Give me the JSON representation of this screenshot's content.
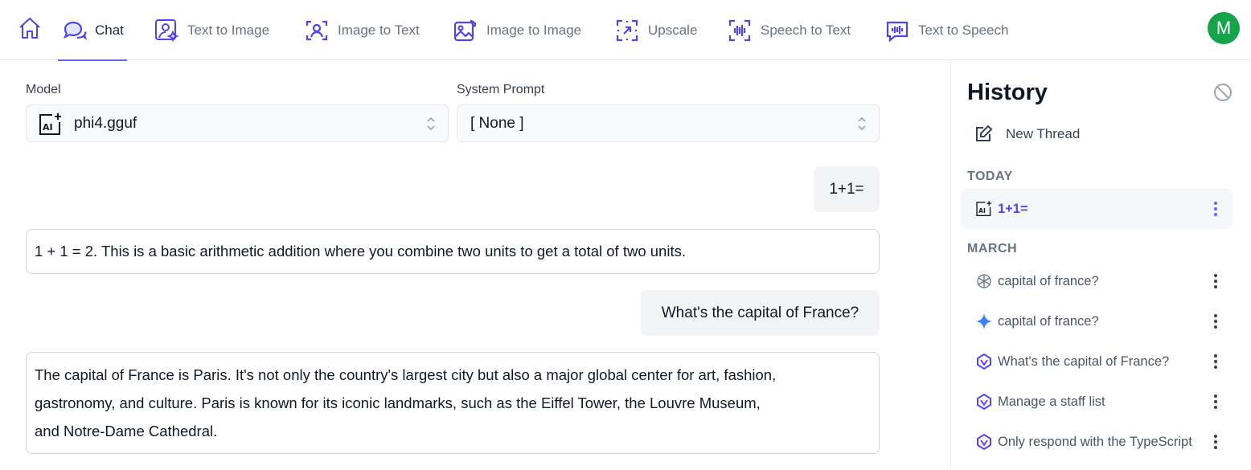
{
  "topnav": {
    "tabs": [
      {
        "label": "Chat",
        "icon": "chat-icon",
        "active": true
      },
      {
        "label": "Text to Image",
        "icon": "text-to-image-icon"
      },
      {
        "label": "Image to Text",
        "icon": "image-to-text-icon"
      },
      {
        "label": "Image to Image",
        "icon": "image-to-image-icon"
      },
      {
        "label": "Upscale",
        "icon": "upscale-icon"
      },
      {
        "label": "Speech to Text",
        "icon": "speech-to-text-icon"
      },
      {
        "label": "Text to Speech",
        "icon": "text-to-speech-icon"
      }
    ],
    "avatar_initial": "M",
    "accent_color": "#4f46e5",
    "avatar_color": "#16a34a"
  },
  "chat": {
    "model_label": "Model",
    "model_value": "phi4.gguf",
    "system_prompt_label": "System Prompt",
    "system_prompt_value": "[ None ]",
    "messages": [
      {
        "role": "user",
        "text": "1+1="
      },
      {
        "role": "assistant",
        "text": "1 + 1 = 2. This is a basic arithmetic addition where you combine two units to get a total of two units."
      },
      {
        "role": "user",
        "text": "What's the capital of France?"
      },
      {
        "role": "assistant",
        "lines": [
          "The capital of France is Paris. It's not only the country's largest city but also a major global center for art, fashion,",
          "gastronomy, and culture. Paris is known for its iconic landmarks, such as the Eiffel Tower, the Louvre Museum,",
          "and Notre-Dame Cathedral."
        ]
      }
    ]
  },
  "history": {
    "title": "History",
    "new_thread_label": "New Thread",
    "groups": [
      {
        "label": "TODAY",
        "items": [
          {
            "title": "1+1=",
            "icon": "ai-model-icon",
            "active": true
          }
        ]
      },
      {
        "label": "MARCH",
        "items": [
          {
            "title": "capital of france?",
            "icon": "openai-icon"
          },
          {
            "title": "capital of france?",
            "icon": "gemini-sparkle-icon"
          },
          {
            "title": "What's the capital of France?",
            "icon": "model-logo-icon"
          },
          {
            "title": "Manage a staff list",
            "icon": "model-logo-icon"
          },
          {
            "title": "Only respond with the TypeScript",
            "icon": "model-logo-icon"
          }
        ]
      }
    ]
  }
}
